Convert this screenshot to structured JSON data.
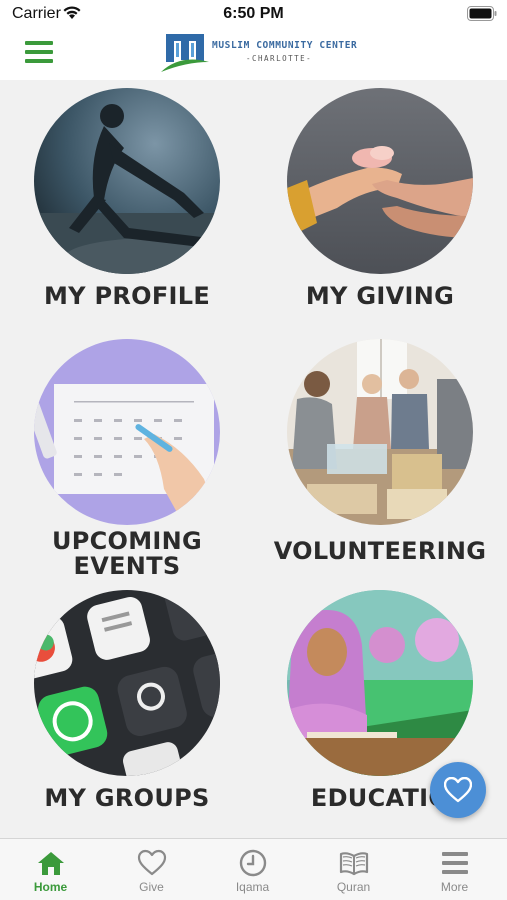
{
  "status_bar": {
    "carrier": "Carrier",
    "time": "6:50 PM"
  },
  "header": {
    "logo_line1": "MUSLIM COMMUNITY CENTER",
    "logo_line2": "-CHARLOTTE-"
  },
  "tiles": [
    {
      "label": "MY PROFILE",
      "image": "person-stretching-photo"
    },
    {
      "label": "MY GIVING",
      "image": "giving-hands-photo"
    },
    {
      "label_line1": "UPCOMING",
      "label_line2": "EVENTS",
      "image": "calendar-photo"
    },
    {
      "label": "VOLUNTEERING",
      "image": "volunteers-photo"
    },
    {
      "label": "MY GROUPS",
      "image": "phone-apps-photo"
    },
    {
      "label": "EDUCATIO",
      "image": "students-classroom-photo"
    }
  ],
  "fab": {
    "icon": "heart-icon"
  },
  "tab_bar": {
    "items": [
      {
        "label": "Home",
        "icon": "home-icon",
        "active": true
      },
      {
        "label": "Give",
        "icon": "heart-icon",
        "active": false
      },
      {
        "label": "Iqama",
        "icon": "clock-icon",
        "active": false
      },
      {
        "label": "Quran",
        "icon": "book-icon",
        "active": false
      },
      {
        "label": "More",
        "icon": "menu-icon",
        "active": false
      }
    ]
  },
  "colors": {
    "accent_green": "#3b9a3b",
    "fab_blue": "#4c8fd6",
    "logo_blue": "#3a6aa0"
  }
}
